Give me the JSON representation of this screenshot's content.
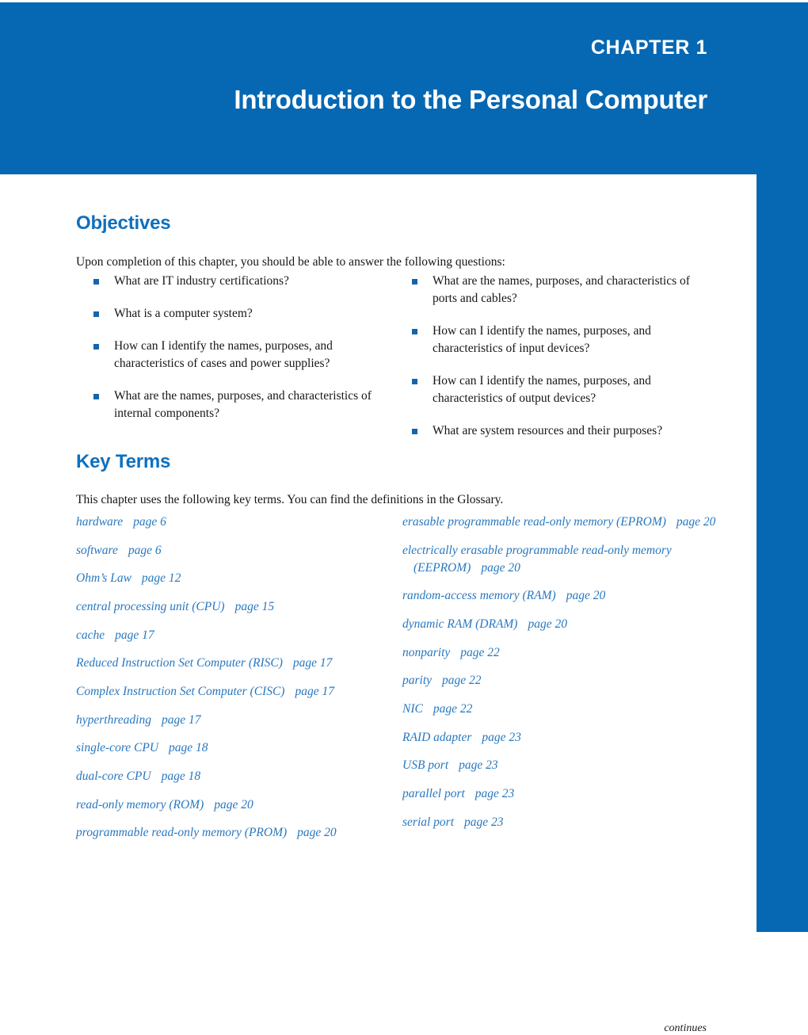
{
  "banner": {
    "chapter_label": "CHAPTER 1",
    "chapter_title": "Introduction to the Personal Computer",
    "background_color": "#0668b3",
    "text_color": "#ffffff"
  },
  "theme": {
    "heading_blue": "#0e70be",
    "keyterm_blue": "#2878c0",
    "bullet_blue": "#1565ac",
    "body_text": "#161616"
  },
  "objectives": {
    "heading": "Objectives",
    "intro": "Upon completion of this chapter, you should be able to answer the following questions:",
    "left_column": [
      "What are IT industry certifications?",
      "What is a computer system?",
      "How can I identify the names, purposes, and characteristics of cases and power supplies?",
      "What are the names, purposes, and characteristics of internal components?"
    ],
    "right_column": [
      "What are the names, purposes, and characteristics of ports and cables?",
      "How can I identify the names, purposes, and characteristics of input devices?",
      "How can I identify the names, purposes, and characteristics of output devices?",
      "What are system resources and their purposes?"
    ]
  },
  "key_terms": {
    "heading": "Key Terms",
    "intro": "This chapter uses the following key terms. You can find the definitions in the Glossary.",
    "left_column": [
      {
        "term": "hardware",
        "page": "page 6"
      },
      {
        "term": "software",
        "page": "page 6"
      },
      {
        "term": "Ohm’s Law",
        "page": "page 12"
      },
      {
        "term": "central processing unit (CPU)",
        "page": "page 15"
      },
      {
        "term": "cache",
        "page": "page 17"
      },
      {
        "term": "Reduced Instruction Set Computer (RISC)",
        "page": "page 17"
      },
      {
        "term": "Complex Instruction Set Computer (CISC)",
        "page": "page 17"
      },
      {
        "term": "hyperthreading",
        "page": "page 17"
      },
      {
        "term": "single-core CPU",
        "page": "page 18"
      },
      {
        "term": "dual-core CPU",
        "page": "page 18"
      },
      {
        "term": "read-only memory (ROM)",
        "page": "page 20"
      },
      {
        "term": "programmable read-only memory (PROM)",
        "page": "page 20"
      }
    ],
    "right_column": [
      {
        "term": "erasable programmable read-only memory (EPROM)",
        "page": "page 20"
      },
      {
        "term": "electrically erasable programmable read-only memory (EEPROM)",
        "page": "page 20"
      },
      {
        "term": "random-access memory (RAM)",
        "page": "page 20"
      },
      {
        "term": "dynamic RAM (DRAM)",
        "page": "page 20"
      },
      {
        "term": "nonparity",
        "page": "page 22"
      },
      {
        "term": "parity",
        "page": "page 22"
      },
      {
        "term": "NIC",
        "page": "page 22"
      },
      {
        "term": "RAID adapter",
        "page": "page 23"
      },
      {
        "term": "USB port",
        "page": "page 23"
      },
      {
        "term": "parallel port",
        "page": "page 23"
      },
      {
        "term": "serial port",
        "page": "page 23"
      }
    ]
  },
  "footer": {
    "continues_note": "continues"
  }
}
